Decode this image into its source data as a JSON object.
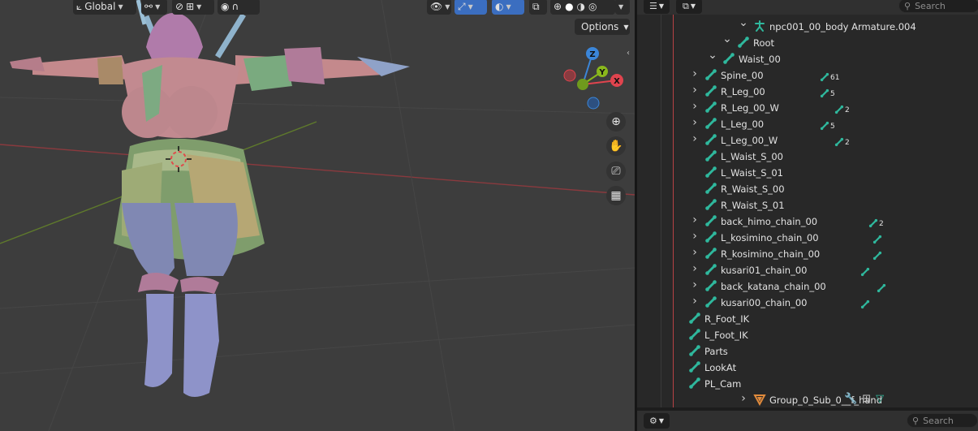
{
  "viewport": {
    "header": {
      "transform_orientation": "Global",
      "options_label": "Options"
    },
    "gizmo": {
      "axis_z": "Z",
      "axis_y": "Y",
      "axis_x": "X",
      "colors": {
        "x": "#e0444e",
        "y": "#8ab81c",
        "z": "#3b86d9",
        "neg_x": "#8a3b40",
        "neg_y": "#566e1f",
        "neg_z": "#2d5080"
      }
    },
    "nav_tools": [
      "zoom-icon",
      "pan-hand-icon",
      "camera-view-icon",
      "ortho-grid-icon"
    ]
  },
  "outliner": {
    "search_placeholder": "Search",
    "rows": [
      {
        "label": "npc001_00_body Armature.004",
        "icon": "armature-icon",
        "expanded": true,
        "badge": ""
      },
      {
        "label": "Root",
        "icon": "armature-data-icon",
        "expanded": true,
        "badge": ""
      },
      {
        "label": "Waist_00",
        "icon": "bone-icon",
        "expanded": true,
        "badge": ""
      },
      {
        "label": "Spine_00",
        "icon": "bone-icon",
        "expanded": false,
        "badge": "61"
      },
      {
        "label": "R_Leg_00",
        "icon": "bone-icon",
        "expanded": false,
        "badge": "5"
      },
      {
        "label": "R_Leg_00_W",
        "icon": "bone-icon",
        "expanded": false,
        "badge": "2"
      },
      {
        "label": "L_Leg_00",
        "icon": "bone-icon",
        "expanded": false,
        "badge": "5"
      },
      {
        "label": "L_Leg_00_W",
        "icon": "bone-icon",
        "expanded": false,
        "badge": "2"
      },
      {
        "label": "L_Waist_S_00",
        "icon": "bone-icon",
        "expanded": null,
        "badge": ""
      },
      {
        "label": "L_Waist_S_01",
        "icon": "bone-icon",
        "expanded": null,
        "badge": ""
      },
      {
        "label": "R_Waist_S_00",
        "icon": "bone-icon",
        "expanded": null,
        "badge": ""
      },
      {
        "label": "R_Waist_S_01",
        "icon": "bone-icon",
        "expanded": null,
        "badge": ""
      },
      {
        "label": "back_himo_chain_00",
        "icon": "bone-icon",
        "expanded": false,
        "badge": "2"
      },
      {
        "label": "L_kosimino_chain_00",
        "icon": "bone-icon",
        "expanded": false,
        "badge": ""
      },
      {
        "label": "R_kosimino_chain_00",
        "icon": "bone-icon",
        "expanded": false,
        "badge": ""
      },
      {
        "label": "kusari01_chain_00",
        "icon": "bone-icon",
        "expanded": false,
        "badge": ""
      },
      {
        "label": "back_katana_chain_00",
        "icon": "bone-icon",
        "expanded": false,
        "badge": ""
      },
      {
        "label": "kusari00_chain_00",
        "icon": "bone-icon",
        "expanded": false,
        "badge": ""
      },
      {
        "label": "R_Foot_IK",
        "icon": "bone-icon",
        "expanded": null,
        "badge": ""
      },
      {
        "label": "L_Foot_IK",
        "icon": "bone-icon",
        "expanded": null,
        "badge": ""
      },
      {
        "label": "Parts",
        "icon": "bone-icon",
        "expanded": null,
        "badge": ""
      },
      {
        "label": "LookAt",
        "icon": "bone-icon",
        "expanded": null,
        "badge": ""
      },
      {
        "label": "PL_Cam",
        "icon": "bone-icon",
        "expanded": null,
        "badge": ""
      },
      {
        "label": "Group_0_Sub_0__f_hand",
        "icon": "mesh-icon",
        "expanded": false,
        "badge": ""
      }
    ],
    "colors": {
      "bone": "#2fb89d",
      "mesh": "#e08a3c",
      "modifier": "#5b8fd9"
    }
  },
  "properties": {
    "search_placeholder": "Search"
  }
}
